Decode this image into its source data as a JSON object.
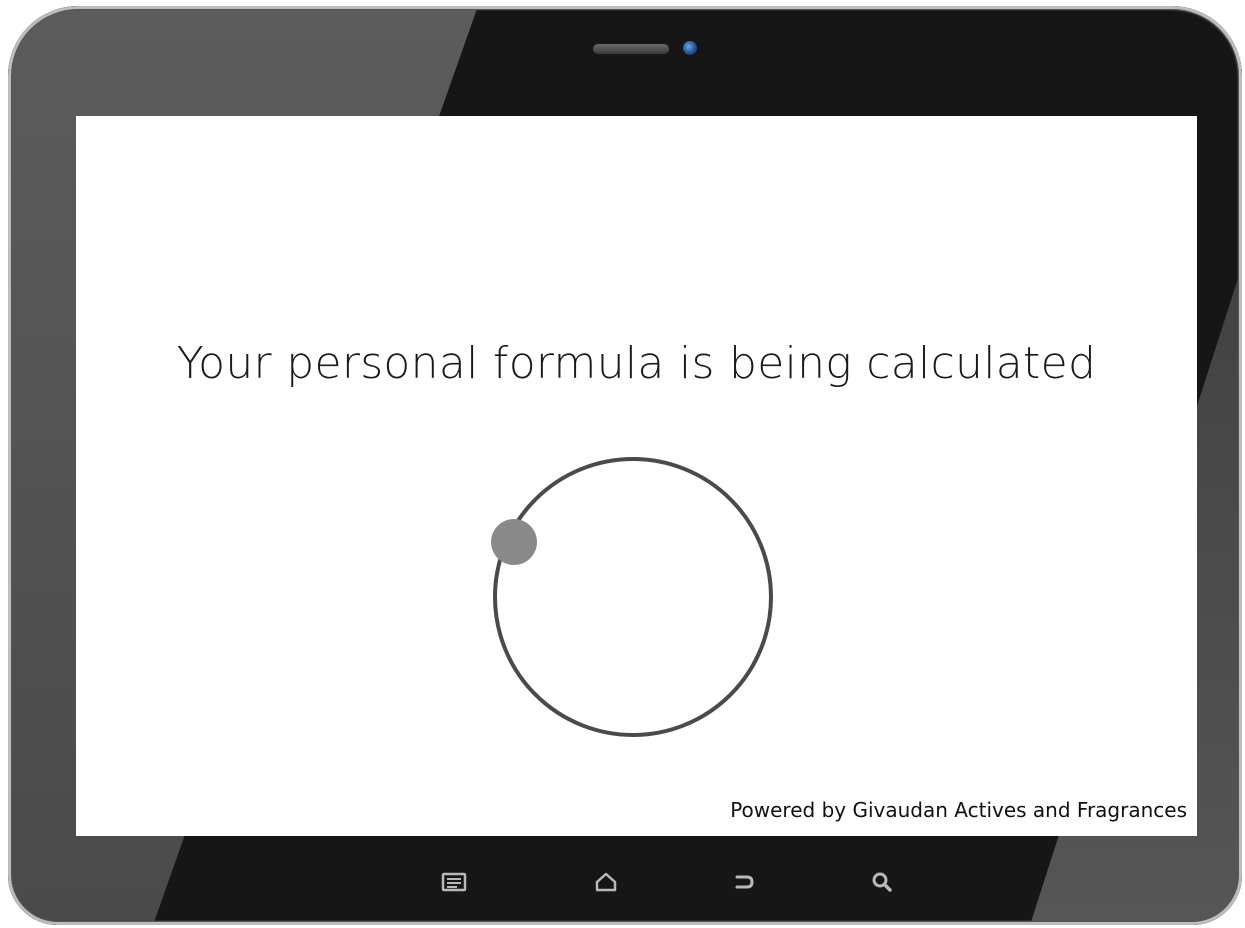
{
  "screen": {
    "headline": "Your personal formula is being calculated",
    "footer_credit": "Powered by Givaudan Actives and Fragrances"
  },
  "loader": {
    "type": "circular-spinner",
    "ring_color": "#4a4a4a",
    "dot_color": "#8a8a8a"
  },
  "device": {
    "bezel_color": "#161616",
    "nav_icons": [
      "menu-icon",
      "home-icon",
      "back-icon",
      "search-icon"
    ],
    "nav_icon_color": "#b8b8b8",
    "camera_color": "#2c5fa8"
  }
}
